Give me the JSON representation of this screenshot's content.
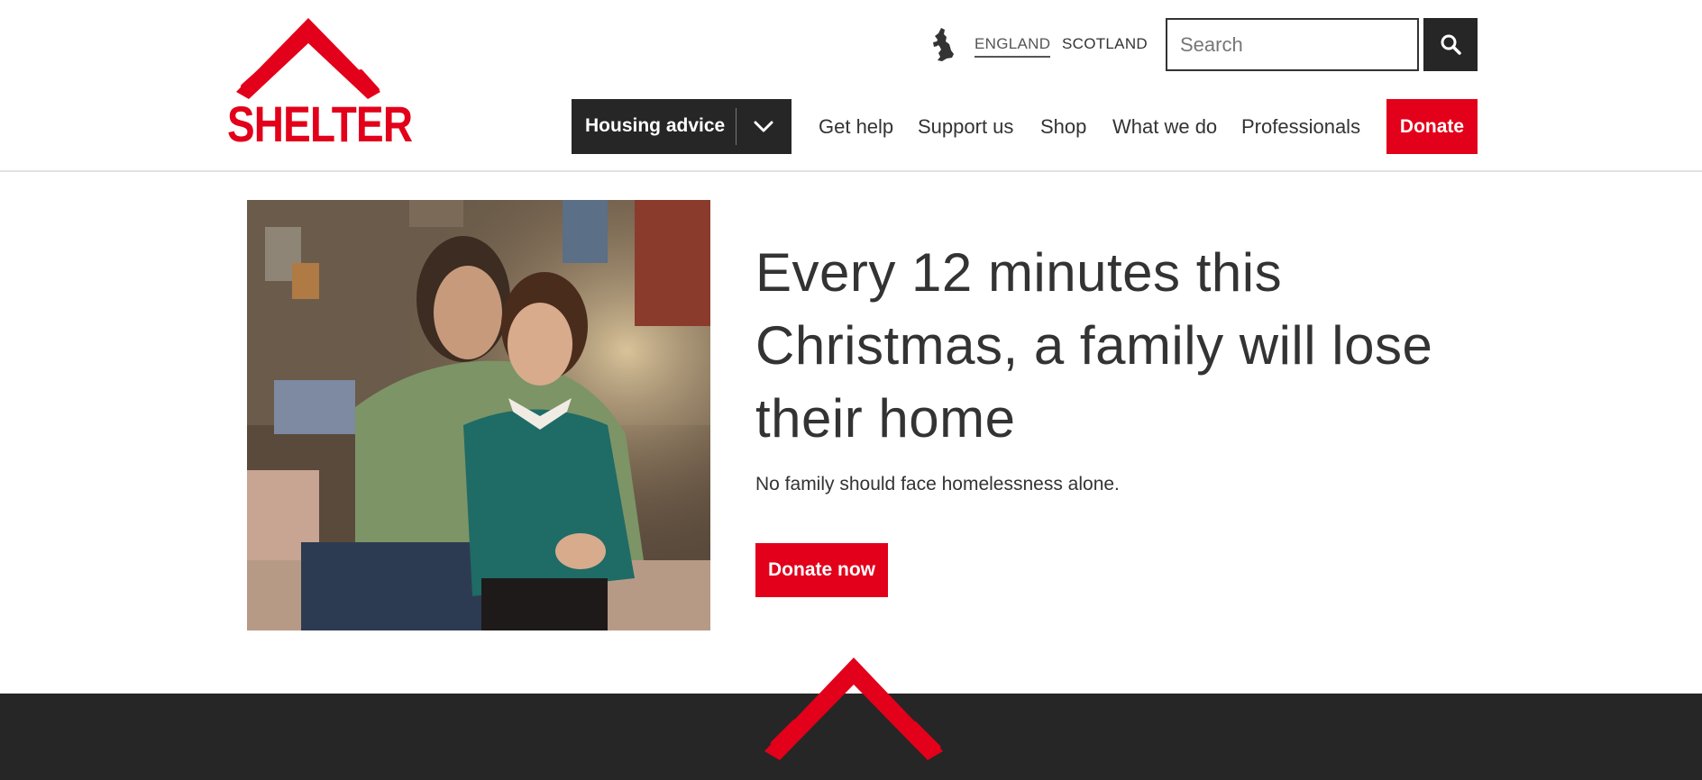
{
  "brand": {
    "name": "SHELTER",
    "accent_color": "#e2001a",
    "dark_color": "#262626"
  },
  "header": {
    "map_icon": "uk-map-icon",
    "regions": [
      {
        "label": "ENGLAND",
        "active": true
      },
      {
        "label": "SCOTLAND",
        "active": false
      }
    ],
    "search": {
      "placeholder": "Search",
      "value": "",
      "button_icon": "search-icon"
    },
    "nav": {
      "housing_advice": "Housing advice",
      "housing_icon": "chevron-down-icon",
      "links": [
        "Get help",
        "Support us",
        "Shop",
        "What we do",
        "Professionals"
      ],
      "donate": "Donate"
    }
  },
  "hero": {
    "image_alt": "Mother and son sitting together in a cramped room",
    "title": "Every 12 minutes this Christmas, a family will lose their home",
    "subtitle": "No family should face homelessness alone.",
    "cta": "Donate now"
  },
  "footer": {
    "logo_icon": "shelter-roof-icon"
  }
}
